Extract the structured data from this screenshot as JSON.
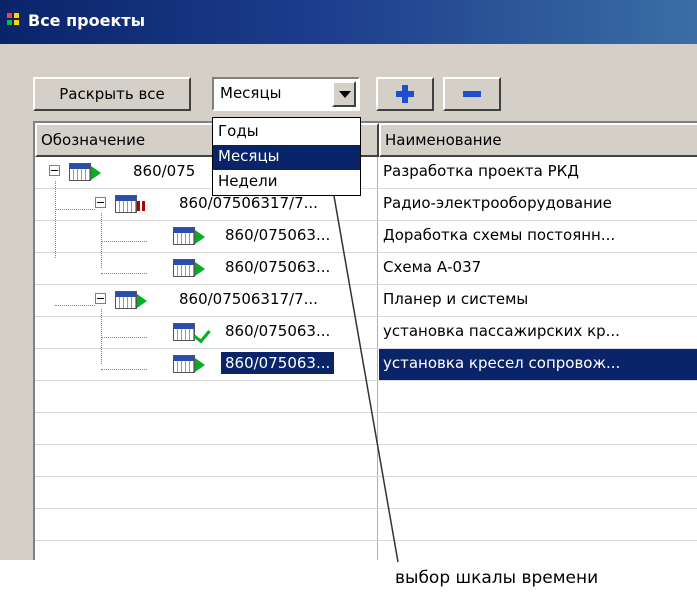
{
  "window": {
    "title": "Все проекты"
  },
  "toolbar": {
    "expand_all_label": "Раскрыть все",
    "scale_value": "Месяцы",
    "add_label": "+",
    "remove_label": "−"
  },
  "dropdown": {
    "options": [
      "Годы",
      "Месяцы",
      "Недели"
    ],
    "selected": "Месяцы"
  },
  "grid": {
    "columns": [
      "Обозначение",
      "Наименование"
    ],
    "rows": [
      {
        "code": "860/075",
        "name": "Разработка проекта РКД",
        "status": "play"
      },
      {
        "code": "860/07506317/7...",
        "name": "Радио-электрооборудование",
        "status": "pause"
      },
      {
        "code": "860/075063...",
        "name": "Доработка схемы постоянн...",
        "status": "play"
      },
      {
        "code": "860/075063...",
        "name": "Схема А-037",
        "status": "play"
      },
      {
        "code": "860/07506317/7...",
        "name": "Планер и системы",
        "status": "play"
      },
      {
        "code": "860/075063...",
        "name": "установка пассажирских кр...",
        "status": "check"
      },
      {
        "code": "860/075063...",
        "name": "установка кресел сопровож...",
        "status": "play",
        "selected": true
      }
    ]
  },
  "annotation": {
    "text": "выбор шкалы времени"
  },
  "colors": {
    "titlebar": "#0a246a",
    "selection": "#0a246a",
    "add": "#1f4fd0",
    "remove": "#1f4fd0",
    "status_green": "#00b020",
    "status_red": "#b00000"
  }
}
